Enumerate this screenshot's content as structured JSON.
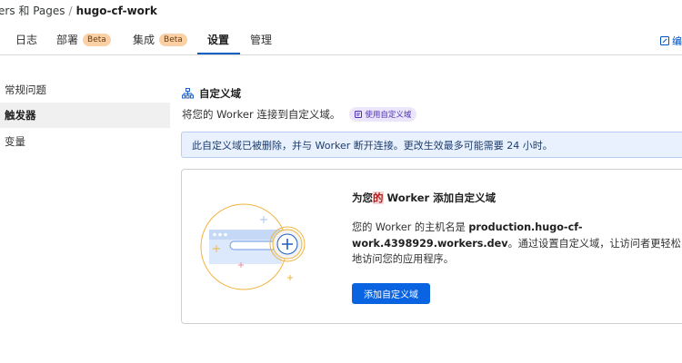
{
  "breadcrumb": {
    "parent": "ers 和 Pages",
    "separator": "/",
    "current": "hugo-cf-work"
  },
  "tabs": [
    {
      "label": "日志",
      "badge": ""
    },
    {
      "label": "部署",
      "badge": "Beta"
    },
    {
      "label": "集成",
      "badge": "Beta"
    },
    {
      "label": "设置",
      "badge": ""
    },
    {
      "label": "管理",
      "badge": ""
    }
  ],
  "active_tab": "设置",
  "edit_link": {
    "label": "编"
  },
  "sidebar": {
    "items": [
      {
        "label": "常规问题"
      },
      {
        "label": "触发器"
      },
      {
        "label": "变量"
      }
    ],
    "active": "触发器"
  },
  "section": {
    "title": "自定义域",
    "description": "将您的 Worker 连接到自定义域。",
    "doc_link": "使用自定义域"
  },
  "alert": {
    "text": "此自定义域已被删除，并与 Worker 断开连接。更改生效最多可能需要 24 小时。"
  },
  "card": {
    "title_prefix": "为您",
    "title_highlight": "的",
    "title_suffix": " Worker 添加自定义域",
    "body_prefix": "您的 Worker 的主机名是 ",
    "hostname": "production.hugo-cf-work.4398929.workers.dev",
    "body_suffix": "。通过设置自定义域，让访问者更轻松地访问您的应用程序。",
    "button_label": "添加自定义域"
  },
  "colors": {
    "accent": "#0a63e0",
    "badge_bg": "#fbd0a6",
    "alert_bg": "#e8f1fd",
    "illustration_orange": "#f0b43c"
  }
}
